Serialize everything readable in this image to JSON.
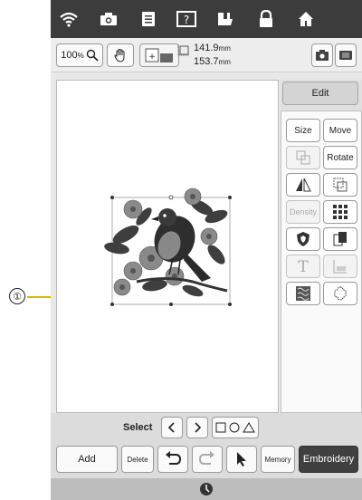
{
  "callout": {
    "number": "①"
  },
  "toolbar": {
    "zoom": "100",
    "zoom_unit": "%",
    "width": "141.9",
    "height": "153.7",
    "unit": "mm"
  },
  "panel": {
    "edit_tab": "Edit",
    "size": "Size",
    "move": "Move",
    "rotate": "Rotate",
    "density": "Density"
  },
  "bottom": {
    "select_label": "Select",
    "add": "Add",
    "delete": "Delete",
    "memory": "Memory",
    "embroidery": "Embroidery"
  },
  "icons": {
    "status": [
      "wifi-icon",
      "camera-icon",
      "document-icon",
      "help-icon",
      "thread-icon",
      "lock-icon",
      "home-icon"
    ],
    "toolbar": [
      "magnifier-icon",
      "hand-icon",
      "layout-icon",
      "size-icon",
      "camera-icon",
      "scan-icon"
    ]
  }
}
